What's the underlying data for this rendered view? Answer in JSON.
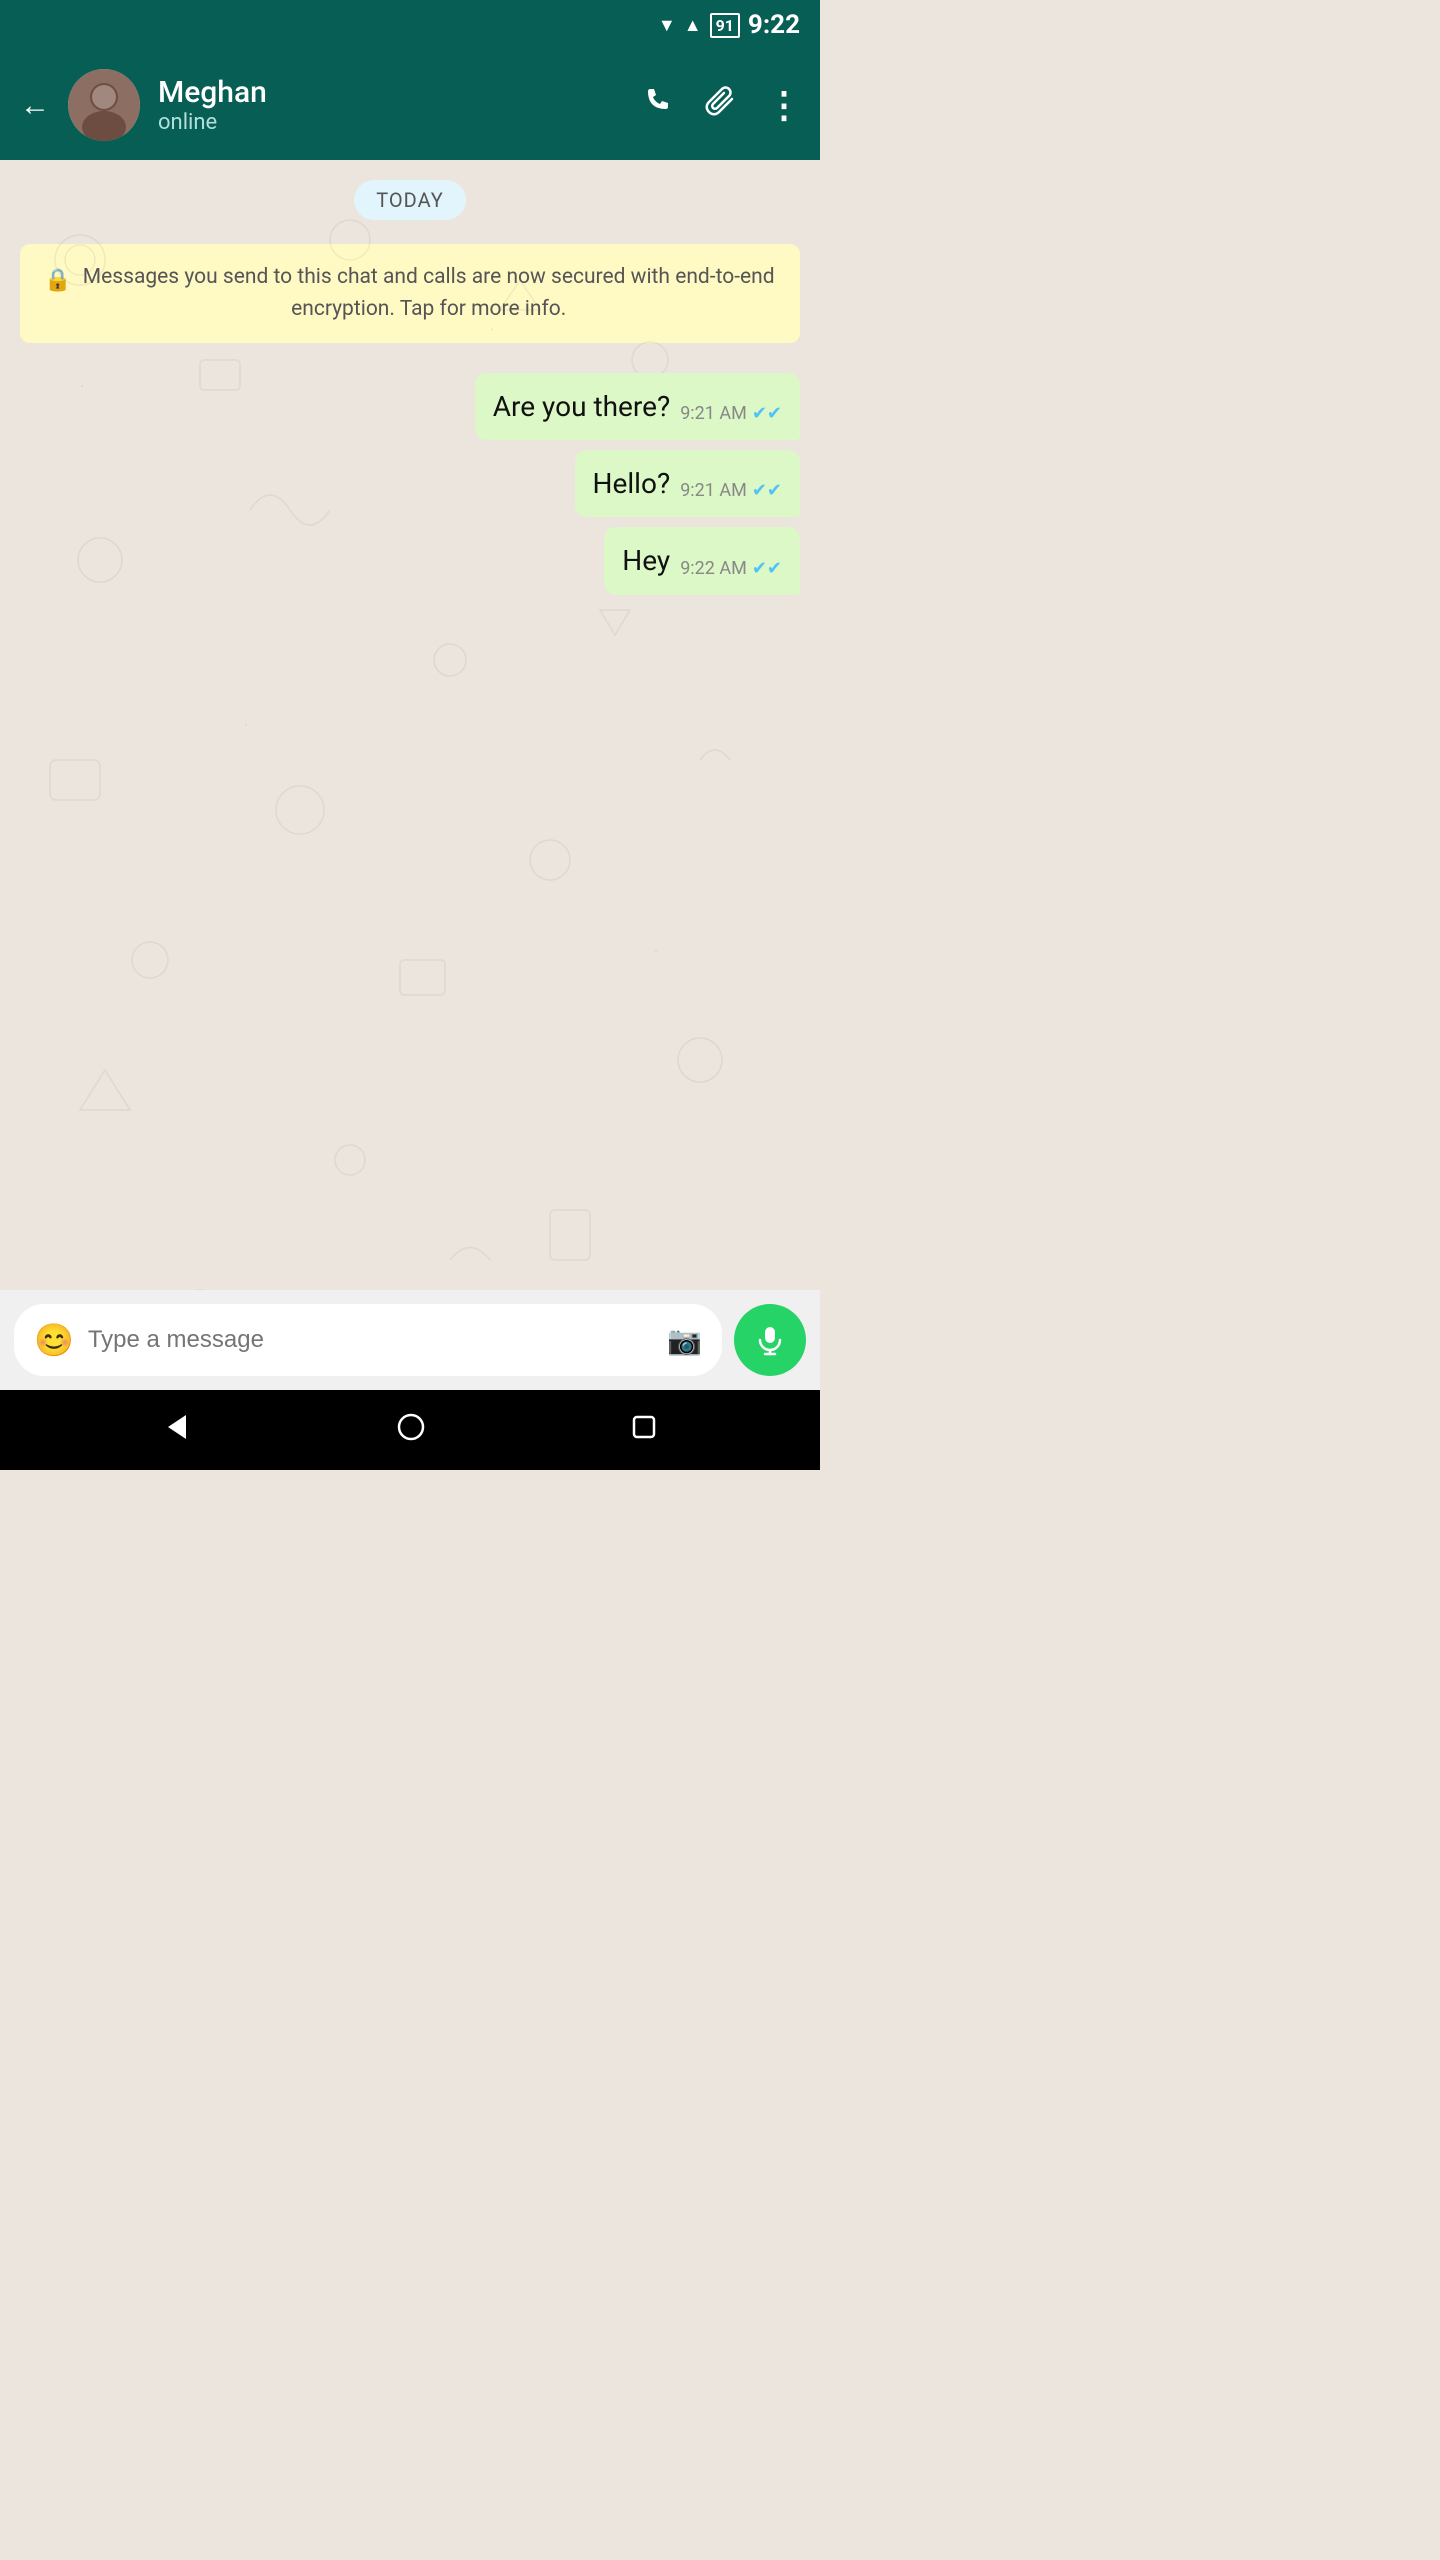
{
  "statusBar": {
    "time": "9:22",
    "batteryLevel": "91"
  },
  "header": {
    "backLabel": "←",
    "contactName": "Meghan",
    "contactStatus": "online",
    "callIcon": "📞",
    "attachIcon": "📎",
    "menuIcon": "⋮"
  },
  "chat": {
    "dateBadge": "TODAY",
    "encryptionNotice": "Messages you send to this chat and calls are now secured with end-to-end encryption. Tap for more info.",
    "lockIcon": "🔒",
    "messages": [
      {
        "id": "msg1",
        "text": "Are you there?",
        "time": "9:21 AM",
        "type": "sent",
        "readReceipt": "✔✔"
      },
      {
        "id": "msg2",
        "text": "Hello?",
        "time": "9:21 AM",
        "type": "sent",
        "readReceipt": "✔✔"
      },
      {
        "id": "msg3",
        "text": "Hey",
        "time": "9:22 AM",
        "type": "sent",
        "readReceipt": "✔✔"
      }
    ]
  },
  "inputArea": {
    "placeholder": "Type a message",
    "emojiIcon": "😊",
    "cameraIcon": "📷",
    "micIcon": "🎤"
  },
  "navBar": {
    "backIcon": "◀",
    "homeIcon": "○",
    "recentIcon": "□"
  }
}
